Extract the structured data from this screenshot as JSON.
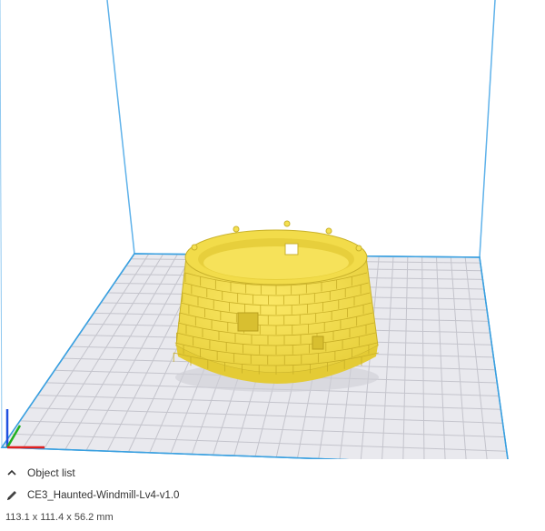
{
  "object_list": {
    "label": "Object list",
    "icon": "chevron-up-icon"
  },
  "object": {
    "filename": "CE3_Haunted-Windmill-Lv4-v1.0",
    "icon": "pencil-icon",
    "dimensions": "113.1 x 111.4 x 56.2 mm"
  },
  "colors": {
    "model": "#f5e050",
    "model_shade": "#d9c237",
    "build_plate": "#e9e9ee",
    "grid_line": "#c6c6cf",
    "volume_edge": "#3aa0e0",
    "axis_x": "#e02020",
    "axis_y": "#20b020",
    "axis_z": "#2050e0"
  }
}
